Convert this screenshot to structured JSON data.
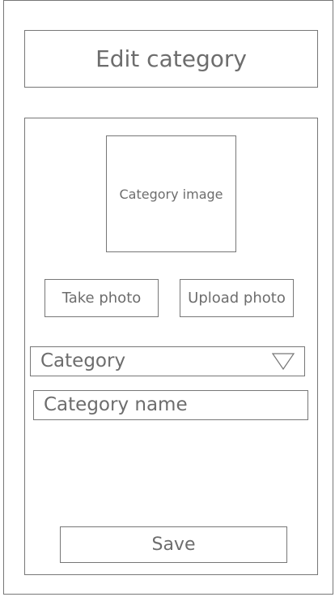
{
  "header": {
    "title": "Edit category"
  },
  "form": {
    "image_placeholder": "Category image",
    "take_photo_label": "Take photo",
    "upload_photo_label": "Upload photo",
    "category_select": {
      "selected": "Category"
    },
    "category_name": {
      "placeholder": "Category name",
      "value": ""
    },
    "save_label": "Save"
  },
  "icons": {
    "dropdown": "chevron-down-icon"
  },
  "colors": {
    "border": "#777777",
    "text": "#6d6d6d",
    "background": "#ffffff"
  }
}
